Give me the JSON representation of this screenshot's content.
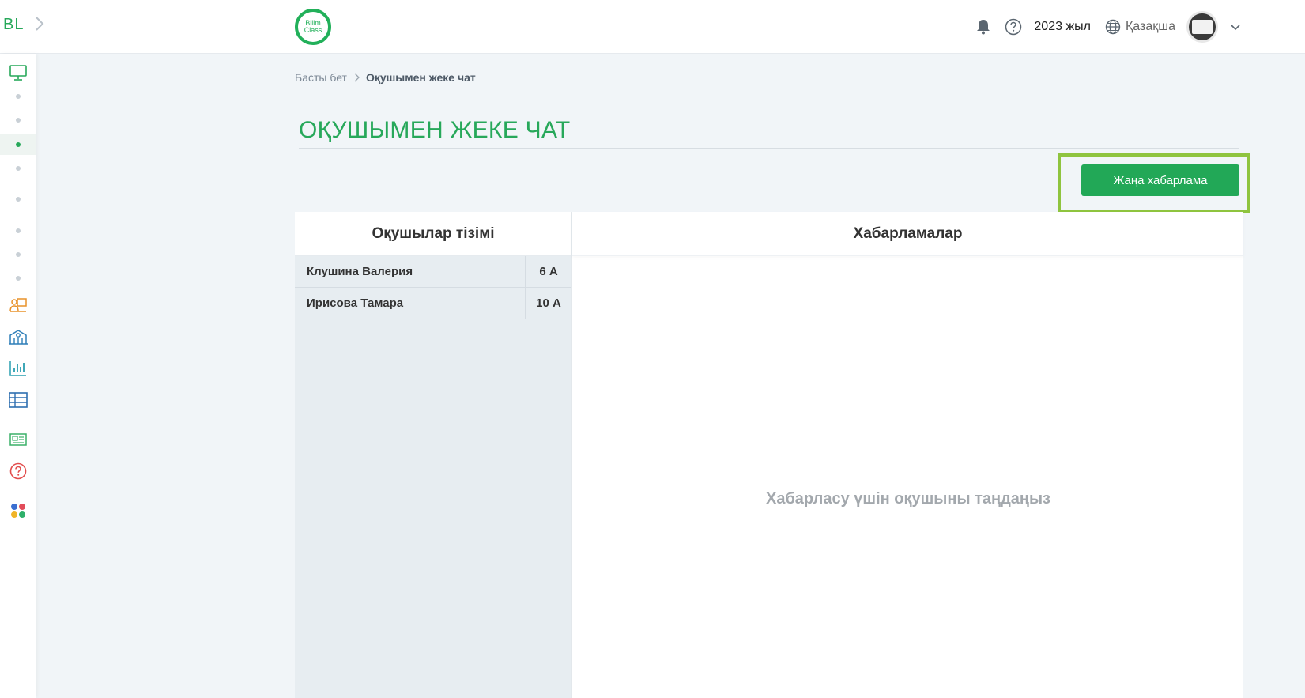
{
  "header": {
    "bl_logo": "BL",
    "brand_line1": "Bilim",
    "brand_line2": "Class",
    "year": "2023 жыл",
    "language": "Қазақша"
  },
  "breadcrumb": {
    "home": "Басты бет",
    "current": "Оқушымен жеке чат"
  },
  "page": {
    "title": "ОҚУШЫМЕН ЖЕКЕ ЧАТ",
    "new_message_button": "Жаңа хабарлама"
  },
  "students_panel": {
    "title": "Оқушылар тізімі",
    "students": [
      {
        "name": "Клушина Валерия",
        "class": "6 А"
      },
      {
        "name": "Ирисова Тамара",
        "class": "10 А"
      }
    ]
  },
  "messages_panel": {
    "title": "Хабарламалар",
    "empty_text": "Хабарласу үшін оқушыны таңдаңыз"
  },
  "colors": {
    "accent": "#27a85a",
    "highlight": "#8fc43f"
  },
  "sidebar": {
    "icons": [
      "monitor-icon",
      "teacher-icon",
      "school-icon",
      "chart-icon",
      "table-icon",
      "news-icon",
      "help-icon",
      "apps-icon"
    ]
  }
}
